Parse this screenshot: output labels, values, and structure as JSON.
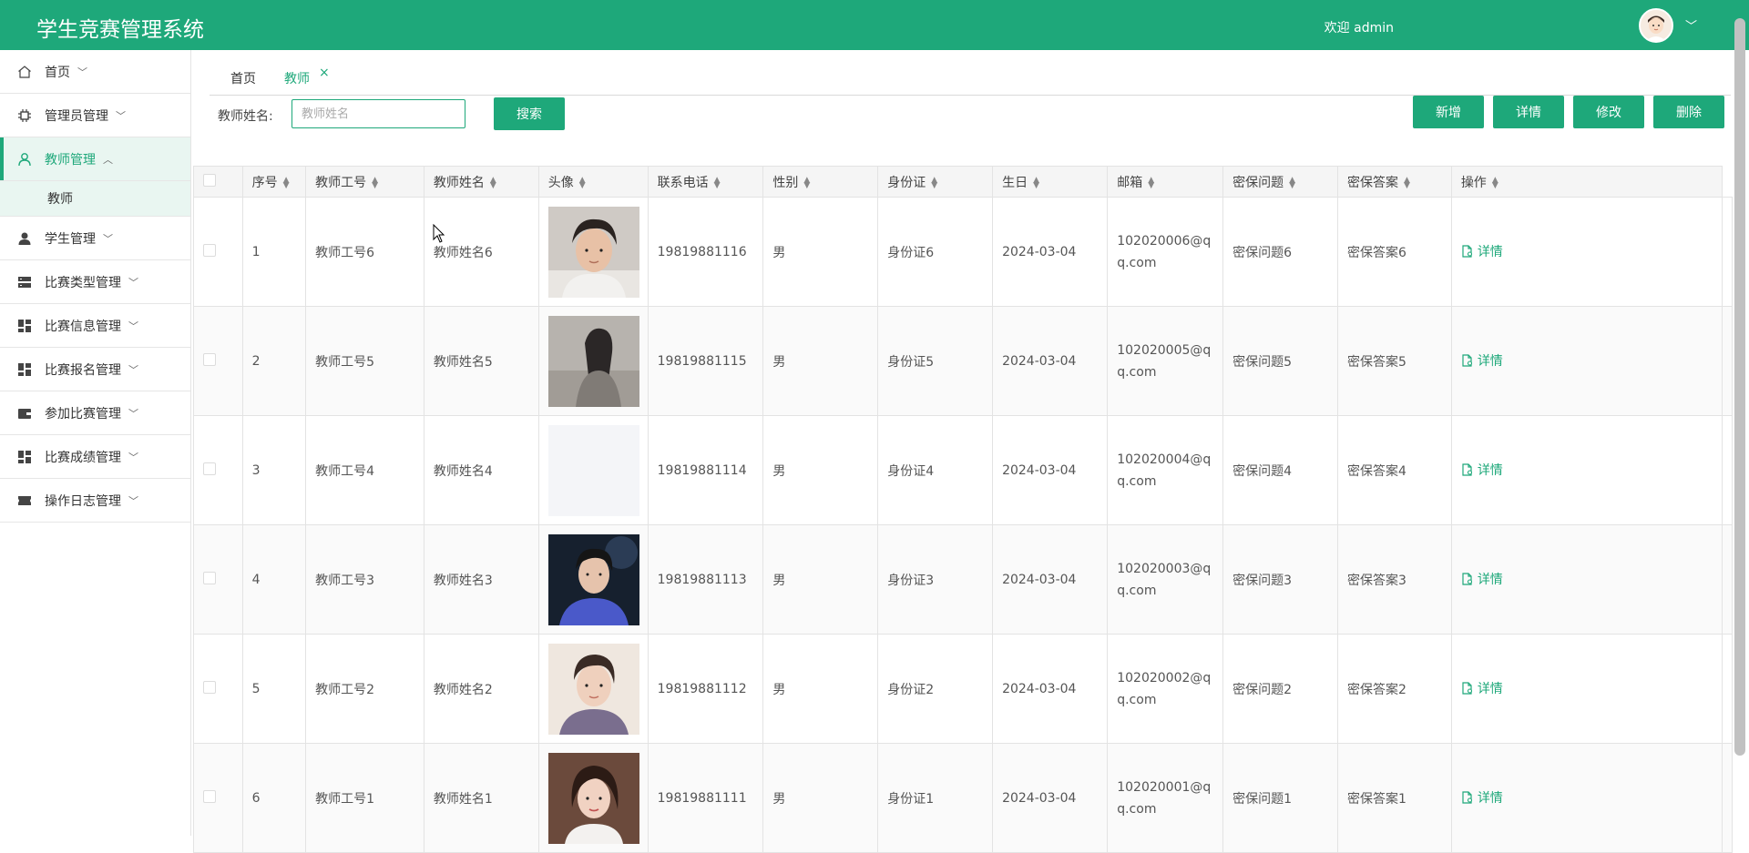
{
  "app": {
    "title": "学生竞赛管理系统",
    "welcome": "欢迎 admin"
  },
  "colors": {
    "primary": "#1ea87a"
  },
  "sidebar": {
    "items": [
      {
        "label": "首页",
        "icon": "home-icon",
        "chevron": "down"
      },
      {
        "label": "管理员管理",
        "icon": "chip-icon",
        "chevron": "down"
      },
      {
        "label": "教师管理",
        "icon": "user-outline-icon",
        "chevron": "up",
        "active": true
      },
      {
        "label": "学生管理",
        "icon": "user-icon",
        "chevron": "down"
      },
      {
        "label": "比赛类型管理",
        "icon": "server-icon",
        "chevron": "down"
      },
      {
        "label": "比赛信息管理",
        "icon": "dashboard-icon",
        "chevron": "down"
      },
      {
        "label": "比赛报名管理",
        "icon": "dashboard-icon",
        "chevron": "down"
      },
      {
        "label": "参加比赛管理",
        "icon": "wallet-icon",
        "chevron": "down"
      },
      {
        "label": "比赛成绩管理",
        "icon": "dashboard-icon",
        "chevron": "down"
      },
      {
        "label": "操作日志管理",
        "icon": "ticket-icon",
        "chevron": "down"
      }
    ],
    "sub_item": "教师"
  },
  "tabs": [
    {
      "label": "首页"
    },
    {
      "label": "教师",
      "active": true,
      "close": "×"
    }
  ],
  "search": {
    "label": "教师姓名:",
    "placeholder": "教师姓名",
    "value": "",
    "button": "搜索"
  },
  "actions": {
    "add": "新增",
    "detail": "详情",
    "edit": "修改",
    "delete": "删除"
  },
  "table": {
    "headers": [
      "序号",
      "教师工号",
      "教师姓名",
      "头像",
      "联系电话",
      "性别",
      "身份证",
      "生日",
      "邮箱",
      "密保问题",
      "密保答案",
      "操作"
    ],
    "action_label": "详情",
    "rows": [
      {
        "no": "1",
        "code": "教师工号6",
        "name": "教师姓名6",
        "avatar": "photo-male-hoodie",
        "phone": "19819881116",
        "gender": "男",
        "idcard": "身份证6",
        "birthday": "2024-03-04",
        "email": "102020006@qq.com",
        "question": "密保问题6",
        "answer": "密保答案6"
      },
      {
        "no": "2",
        "code": "教师工号5",
        "name": "教师姓名5",
        "avatar": "photo-female-sitting",
        "phone": "19819881115",
        "gender": "男",
        "idcard": "身份证5",
        "birthday": "2024-03-04",
        "email": "102020005@qq.com",
        "question": "密保问题5",
        "answer": "密保答案5"
      },
      {
        "no": "3",
        "code": "教师工号4",
        "name": "教师姓名4",
        "avatar": "photo-blank",
        "phone": "19819881114",
        "gender": "男",
        "idcard": "身份证4",
        "birthday": "2024-03-04",
        "email": "102020004@qq.com",
        "question": "密保问题4",
        "answer": "密保答案4"
      },
      {
        "no": "4",
        "code": "教师工号3",
        "name": "教师姓名3",
        "avatar": "photo-male-blue",
        "phone": "19819881113",
        "gender": "男",
        "idcard": "身份证3",
        "birthday": "2024-03-04",
        "email": "102020003@qq.com",
        "question": "密保问题3",
        "answer": "密保答案3"
      },
      {
        "no": "5",
        "code": "教师工号2",
        "name": "教师姓名2",
        "avatar": "photo-male-portrait",
        "phone": "19819881112",
        "gender": "男",
        "idcard": "身份证2",
        "birthday": "2024-03-04",
        "email": "102020002@qq.com",
        "question": "密保问题2",
        "answer": "密保答案2"
      },
      {
        "no": "6",
        "code": "教师工号1",
        "name": "教师姓名1",
        "avatar": "photo-female-portrait",
        "phone": "19819881111",
        "gender": "男",
        "idcard": "身份证1",
        "birthday": "2024-03-04",
        "email": "102020001@qq.com",
        "question": "密保问题1",
        "answer": "密保答案1"
      }
    ]
  }
}
